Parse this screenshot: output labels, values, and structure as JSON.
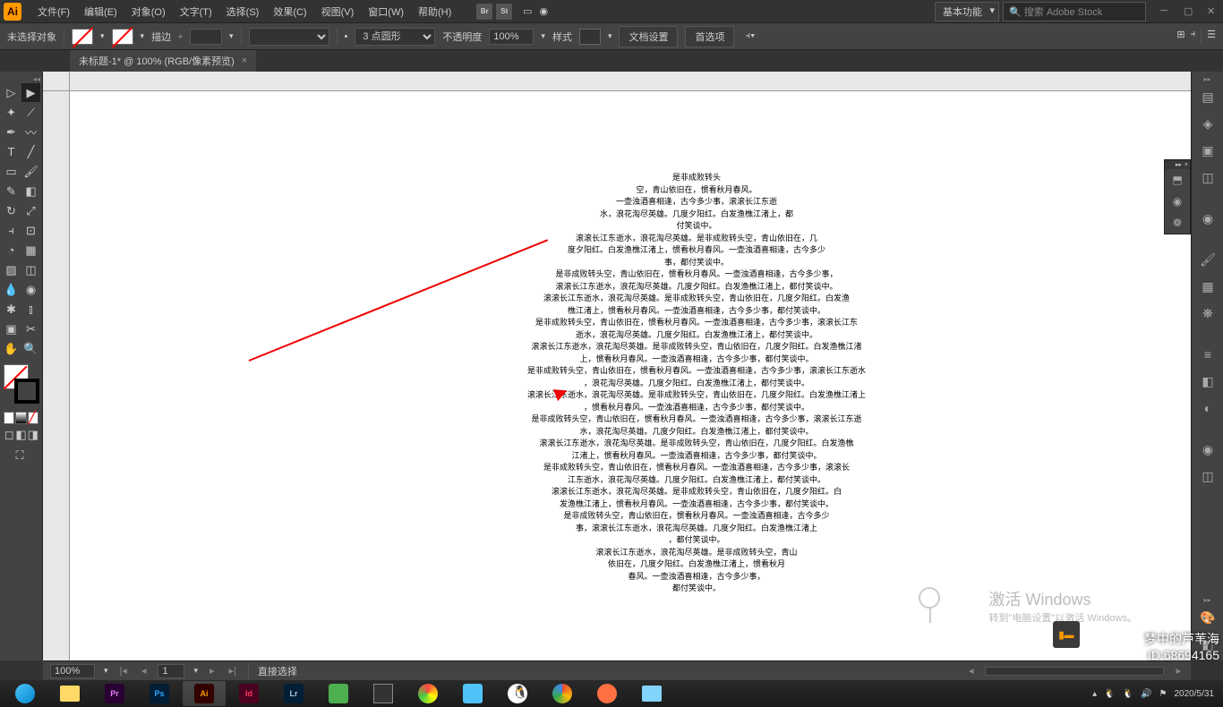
{
  "menubar": {
    "logo": "Ai",
    "items": [
      "文件(F)",
      "编辑(E)",
      "对象(O)",
      "文字(T)",
      "选择(S)",
      "效果(C)",
      "视图(V)",
      "窗口(W)",
      "帮助(H)"
    ],
    "workspace": "基本功能",
    "search_placeholder": "搜索 Adobe Stock"
  },
  "controlbar": {
    "no_selection": "未选择对象",
    "stroke_label": "描边",
    "stroke_pt": "3 点圆形",
    "opacity_label": "不透明度",
    "opacity_value": "100%",
    "style_label": "样式",
    "doc_setup": "文档设置",
    "preferences": "首选项"
  },
  "tab": {
    "title": "未标题-1* @ 100% (RGB/像素预览)"
  },
  "status": {
    "zoom": "100%",
    "page": "1",
    "mode": "直接选择"
  },
  "text_lines": [
    "是非成败转头",
    "空，青山依旧在，惯看秋月春风。",
    "一壶浊酒喜相逢，古今多少事，滚滚长江东逝",
    "水，浪花淘尽英雄。几度夕阳红。白发渔樵江渚上，都",
    "付笑谈中。",
    "滚滚长江东逝水，浪花淘尽英雄。是非成败转头空，青山依旧在，几",
    "度夕阳红。白发渔樵江渚上，惯看秋月春风。一壶浊酒喜相逢，古今多少",
    "事，都付笑谈中。",
    "是非成败转头空，青山依旧在，惯看秋月春风。一壶浊酒喜相逢，古今多少事，",
    "滚滚长江东逝水，浪花淘尽英雄。几度夕阳红。白发渔樵江渚上，都付笑谈中。",
    "滚滚长江东逝水，浪花淘尽英雄。是非成败转头空，青山依旧在，几度夕阳红。白发渔",
    "樵江渚上，惯看秋月春风。一壶浊酒喜相逢，古今多少事，都付笑谈中。",
    "是非成败转头空，青山依旧在，惯看秋月春风。一壶浊酒喜相逢，古今多少事，滚滚长江东",
    "逝水，浪花淘尽英雄。几度夕阳红。白发渔樵江渚上，都付笑谈中。",
    "滚滚长江东逝水，浪花淘尽英雄。是非成败转头空，青山依旧在，几度夕阳红。白发渔樵江渚",
    "上，惯看秋月春风。一壶浊酒喜相逢，古今多少事，都付笑谈中。",
    "是非成败转头空，青山依旧在，惯看秋月春风。一壶浊酒喜相逢，古今多少事，滚滚长江东逝水",
    "，浪花淘尽英雄。几度夕阳红。白发渔樵江渚上，都付笑谈中。",
    "滚滚长江东逝水，浪花淘尽英雄。是非成败转头空，青山依旧在，几度夕阳红。白发渔樵江渚上",
    "，惯看秋月春风。一壶浊酒喜相逢，古今多少事，都付笑谈中。",
    "是非成败转头空，青山依旧在，惯看秋月春风。一壶浊酒喜相逢，古今多少事，滚滚长江东逝",
    "水，浪花淘尽英雄。几度夕阳红。白发渔樵江渚上，都付笑谈中。",
    "滚滚长江东逝水，浪花淘尽英雄。是非成败转头空，青山依旧在，几度夕阳红。白发渔樵",
    "江渚上，惯看秋月春风。一壶浊酒喜相逢，古今多少事，都付笑谈中。",
    "是非成败转头空，青山依旧在，惯看秋月春风。一壶浊酒喜相逢，古今多少事，滚滚长",
    "江东逝水，浪花淘尽英雄。几度夕阳红。白发渔樵江渚上，都付笑谈中。",
    "滚滚长江东逝水，浪花淘尽英雄。是非成败转头空，青山依旧在，几度夕阳红。白",
    "发渔樵江渚上，惯看秋月春风。一壶浊酒喜相逢，古今多少事，都付笑谈中。",
    "是非成败转头空，青山依旧在，惯看秋月春风。一壶浊酒喜相逢，古今多少",
    "事，滚滚长江东逝水，浪花淘尽英雄。几度夕阳红。白发渔樵江渚上",
    "，都付笑谈中。",
    "滚滚长江东逝水，浪花淘尽英雄。是非成败转头空，青山",
    "依旧在，几度夕阳红。白发渔樵江渚上，惯看秋月",
    "春风。一壶浊酒喜相逢，古今多少事，",
    "都付笑谈中。"
  ],
  "watermark": {
    "line1": "激活 Windows",
    "line2": "转到\"电脑设置\"以激活 Windows。"
  },
  "taskbar": {
    "date": "2020/5/31"
  },
  "corner_watermark": {
    "line1": "梦中的芦苇海",
    "line2": "ID:68694165"
  }
}
